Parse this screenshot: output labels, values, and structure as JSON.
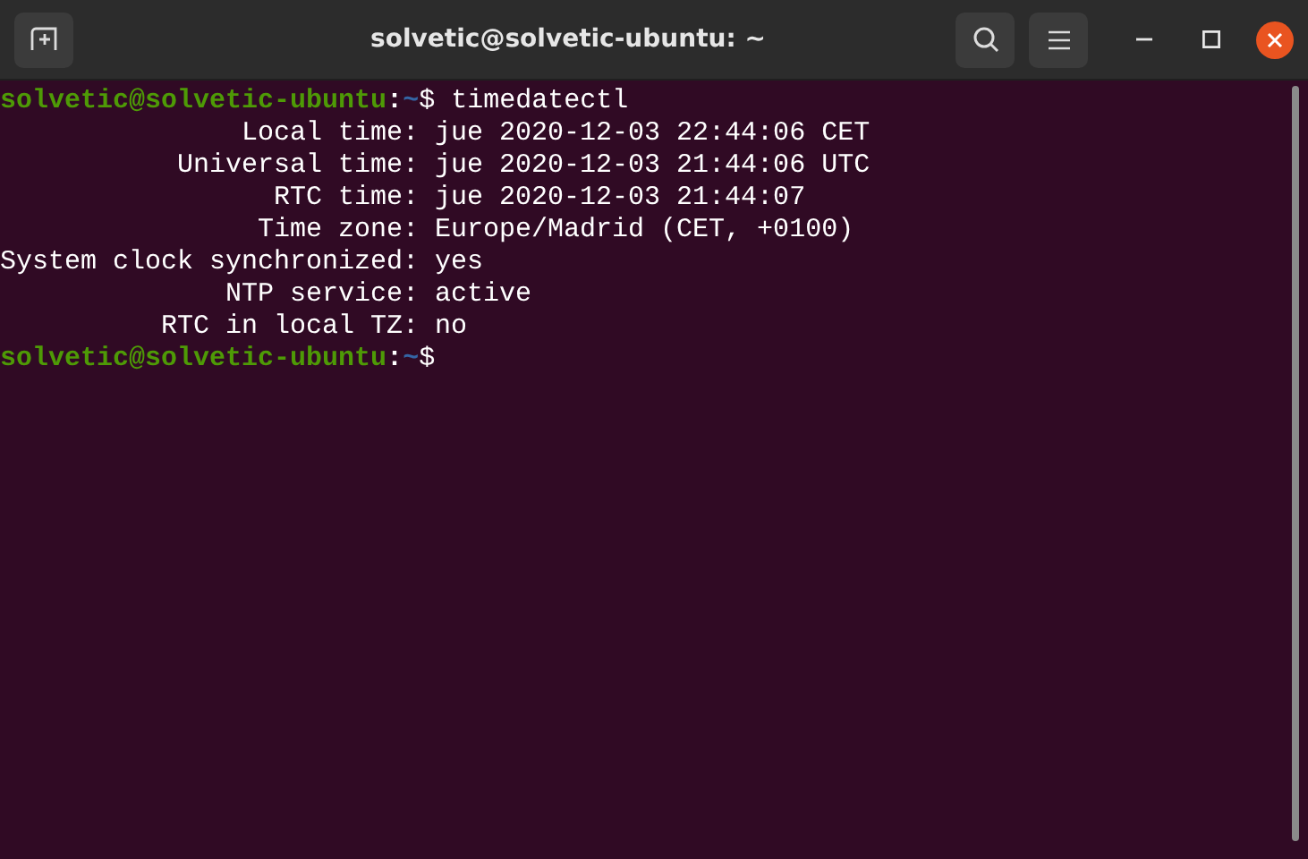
{
  "window": {
    "title": "solvetic@solvetic-ubuntu: ~"
  },
  "terminal": {
    "lines": [
      {
        "kind": "prompt",
        "user": "solvetic@solvetic-ubuntu",
        "separator": ":",
        "path": "~",
        "symbol": "$",
        "command": "timedatectl"
      },
      {
        "kind": "output",
        "label": "Local time:",
        "value": "jue 2020-12-03 22:44:06 CET"
      },
      {
        "kind": "output",
        "label": "Universal time:",
        "value": "jue 2020-12-03 21:44:06 UTC"
      },
      {
        "kind": "output",
        "label": "RTC time:",
        "value": "jue 2020-12-03 21:44:07"
      },
      {
        "kind": "output",
        "label": "Time zone:",
        "value": "Europe/Madrid (CET, +0100)"
      },
      {
        "kind": "output",
        "label": "System clock synchronized:",
        "value": "yes"
      },
      {
        "kind": "output",
        "label": "NTP service:",
        "value": "active"
      },
      {
        "kind": "output",
        "label": "RTC in local TZ:",
        "value": "no"
      },
      {
        "kind": "prompt",
        "user": "solvetic@solvetic-ubuntu",
        "separator": ":",
        "path": "~",
        "symbol": "$"
      }
    ]
  }
}
